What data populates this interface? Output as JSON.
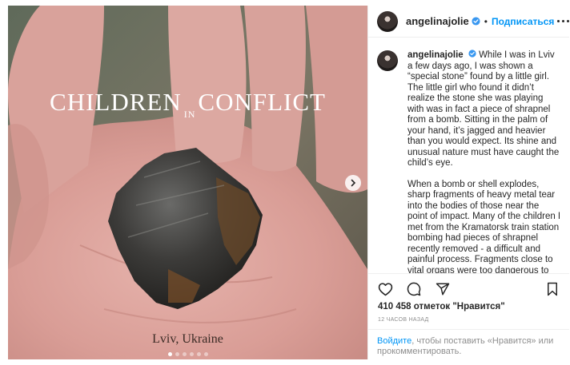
{
  "post": {
    "image": {
      "title_word_1": "CHILDREN",
      "title_word_in": "IN",
      "title_word_2": "CONFLICT",
      "location_text": "Lviv, Ukraine",
      "slide_count": 6,
      "active_slide": 1
    },
    "header": {
      "username": "angelinajolie",
      "separator": "•",
      "follow_label": "Подписаться"
    },
    "caption": {
      "username": "angelinajolie",
      "paragraph_1": "While I was in Lviv a few days ago, I was shown a “special stone” found by a little girl. The little girl who found it didn’t realize the stone she was playing with was in fact a piece of shrapnel from a bomb. Sitting in the palm of your hand, it’s jagged and heavier than you would expect. Its shine and unusual nature must have caught the child’s eye.",
      "paragraph_2": "When a bomb or shell explodes, sharp fragments of heavy metal tear into the bodies of those near the point of impact. Many of the children I met from the Kramatorsk train station bombing had pieces of shrapnel recently removed - a difficult and painful process. Fragments close to vital organs were too dangerous to remove, and remained inside some of the children’s bodies."
    },
    "likes_text": "410 458 отметок \"Нравится\"",
    "time_ago": "12 часов назад",
    "login_prompt": {
      "link_text": "Войдите",
      "rest_text": ", чтобы поставить «Нравится» или прокомментировать."
    }
  },
  "colors": {
    "accent": "#0095f6",
    "text": "#262626",
    "muted": "#8e8e8e",
    "divider": "#efefef"
  },
  "icons": [
    "verified-badge-icon",
    "more-options-icon",
    "heart-icon",
    "comment-icon",
    "share-icon",
    "bookmark-icon",
    "chevron-right-icon"
  ]
}
